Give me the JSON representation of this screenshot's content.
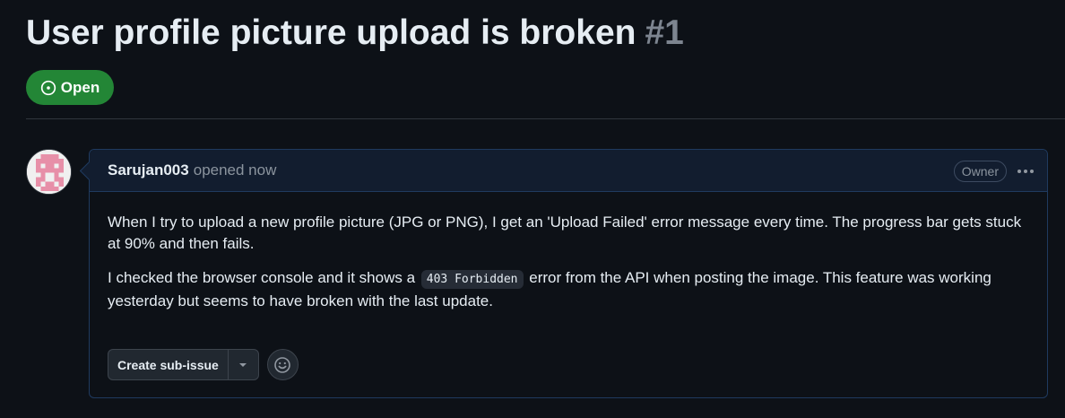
{
  "issue": {
    "title": "User profile picture upload is broken",
    "number": "#1",
    "state": "Open"
  },
  "comment": {
    "author": "Sarujan003",
    "opened_text": "opened now",
    "role_badge": "Owner",
    "paragraph1": "When I try to upload a new profile picture (JPG or PNG), I get an 'Upload Failed' error message every time. The progress bar gets stuck at 90% and then fails.",
    "paragraph2_before": "I checked the browser console and it shows a",
    "paragraph2_code": "403 Forbidden",
    "paragraph2_after": "error from the API when posting the image. This feature was working yesterday but seems to have broken with the last update."
  },
  "actions": {
    "create_sub_issue_label": "Create sub-issue"
  },
  "icons": {
    "state": "issue-opened-icon",
    "more": "kebab-horizontal-icon",
    "dropdown": "triangle-down-icon",
    "reaction": "smiley-icon"
  },
  "colors": {
    "open_badge": "#238636",
    "background": "#0d1117",
    "comment_header": "#121d2f",
    "avatar_pattern": "#e78fa8"
  }
}
